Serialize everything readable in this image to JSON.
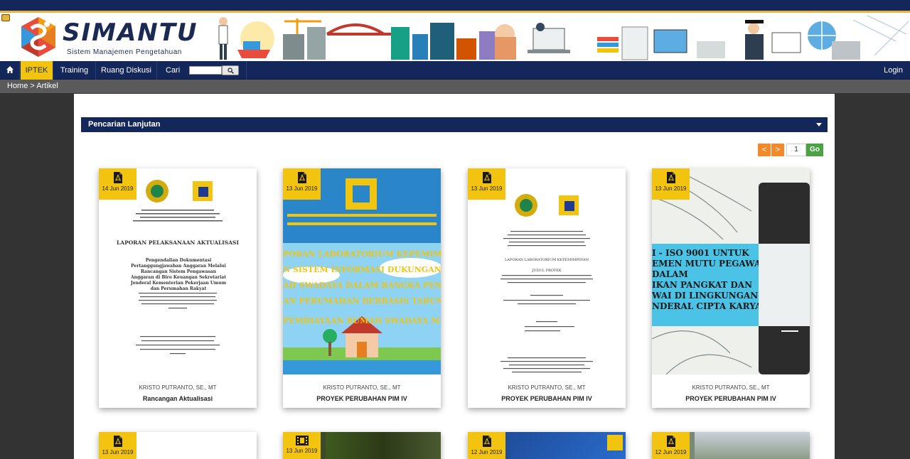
{
  "header": {
    "brand": "SIMANTU",
    "tagline": "Sistem Manajemen Pengetahuan"
  },
  "nav": {
    "home_icon": "home-icon",
    "items": [
      "IPTEK",
      "Training",
      "Ruang Diskusi"
    ],
    "search_label": "Cari",
    "search_value": "",
    "search_icon": "search-icon",
    "login": "Login",
    "active_color": "#f2c30f",
    "bar_color": "#14275a"
  },
  "breadcrumb": "Home > Artikel",
  "advanced_search": {
    "label": "Pencarian Lanjutan",
    "icon": "caret-down-icon"
  },
  "pagination": {
    "prev": "<",
    "next": ">",
    "page": "1",
    "go": "Go"
  },
  "cards_row1": [
    {
      "date": "14 Jun 2019",
      "type_icon": "pdf-icon",
      "author": "KRISTO PUTRANTO, SE., MT",
      "title": "Rancangan Aktualisasi",
      "doc_heading": "LAPORAN PELAKSANAAN AKTUALISASI",
      "doc_subtitle": "Pengendalian Dokumentasi Pertanggungjawaban Anggaran Melalui Rancangan Sistem Pengawasan Anggaran di Biro Keuangan Sekretariat Jenderal Kementerian Pekerjaan Umum dan Perumahan Rakyat"
    },
    {
      "date": "13 Jun 2019",
      "type_icon": "pdf-icon",
      "author": "KRISTO PUTRANTO, SE., MT",
      "title": "PROYEK PERUBAHAN PIM IV",
      "doc_lines": [
        "PORAN LABORATORIUM KEPEMIMPINA",
        "N SISTEM INFORMASI DUKUNGAN KR",
        "AH SWADAYA DALAM RANGKA PENYALU",
        "AN PERUMAHAN BERBASIS TABUNGAN",
        "PEMBIAYAAN RUMAH SWADAYA MELA"
      ]
    },
    {
      "date": "13 Jun 2019",
      "type_icon": "pdf-icon",
      "author": "KRISTO PUTRANTO, SE., MT",
      "title": "PROYEK PERUBAHAN PIM IV",
      "doc_heading": "LAPORAN LABORATORIUM KEPEMIMPINAN",
      "doc_subtitle": "JUDUL PROYEK"
    },
    {
      "date": "13 Jun 2019",
      "type_icon": "pdf-icon",
      "author": "KRISTO PUTRANTO, SE., MT",
      "title": "PROYEK PERUBAHAN PIM IV",
      "doc_lines": [
        "I - ISO 9001 UNTUK",
        "EMEN MUTU PEGAWAI",
        "DALAM",
        "IKAN PANGKAT DAN",
        "WAI DI LINGKUNGAN",
        "NDERAL CIPTA KARYA"
      ]
    }
  ],
  "cards_row2": [
    {
      "date": "13 Jun 2019",
      "type_icon": "pdf-icon"
    },
    {
      "date": "13 Jun 2019",
      "type_icon": "film-icon"
    },
    {
      "date": "12 Jun 2019",
      "type_icon": "pdf-icon"
    },
    {
      "date": "12 Jun 2019",
      "type_icon": "pdf-icon"
    }
  ]
}
